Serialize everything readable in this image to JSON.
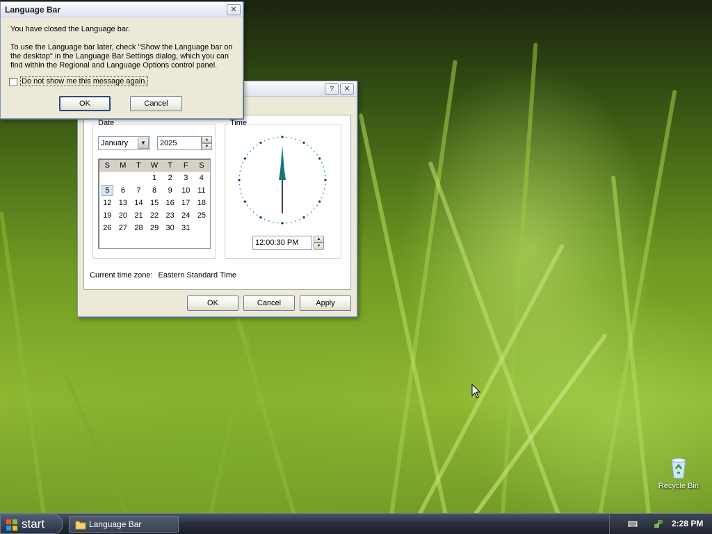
{
  "language_dialog": {
    "title": "Language Bar",
    "close_glyph": "✕",
    "line1": "You have closed the Language bar.",
    "line2": "To use the Language bar later, check \"Show the Language bar on",
    "line3": "the desktop\" in the Language Bar Settings dialog, which you can",
    "line4": "find within the Regional and Language Options control panel.",
    "checkbox_label": "Do not show me this message again.",
    "checkbox_checked": false,
    "ok_label": "OK",
    "cancel_label": "Cancel"
  },
  "datetime_dialog": {
    "help_glyph": "?",
    "close_glyph": "✕",
    "date_group_label": "Date",
    "time_group_label": "Time",
    "month_value": "January",
    "year_value": "2025",
    "weekday_headers": [
      "S",
      "M",
      "T",
      "W",
      "T",
      "F",
      "S"
    ],
    "calendar_rows": [
      [
        "",
        "",
        "",
        "1",
        "2",
        "3",
        "4"
      ],
      [
        "5",
        "6",
        "7",
        "8",
        "9",
        "10",
        "11"
      ],
      [
        "12",
        "13",
        "14",
        "15",
        "16",
        "17",
        "18"
      ],
      [
        "19",
        "20",
        "21",
        "22",
        "23",
        "24",
        "25"
      ],
      [
        "26",
        "27",
        "28",
        "29",
        "30",
        "31",
        ""
      ]
    ],
    "selected_day": "5",
    "time_value": "12:00:30 PM",
    "timezone_label": "Current time zone:",
    "timezone_value": "Eastern Standard Time",
    "ok_label": "OK",
    "cancel_label": "Cancel",
    "apply_label": "Apply",
    "clock_color": "#1a8a8a"
  },
  "desktop": {
    "recycle_bin_label": "Recycle Bin"
  },
  "taskbar": {
    "start_label": "start",
    "task_label": "Language Bar",
    "clock": "2:28 PM"
  },
  "icons": [
    "close-icon",
    "help-icon",
    "dropdown-arrow-icon",
    "spin-up-icon",
    "spin-down-icon",
    "windows-logo-icon",
    "folder-icon",
    "keyboard-icon",
    "network-icon",
    "recycle-bin-icon",
    "mouse-cursor-icon"
  ]
}
